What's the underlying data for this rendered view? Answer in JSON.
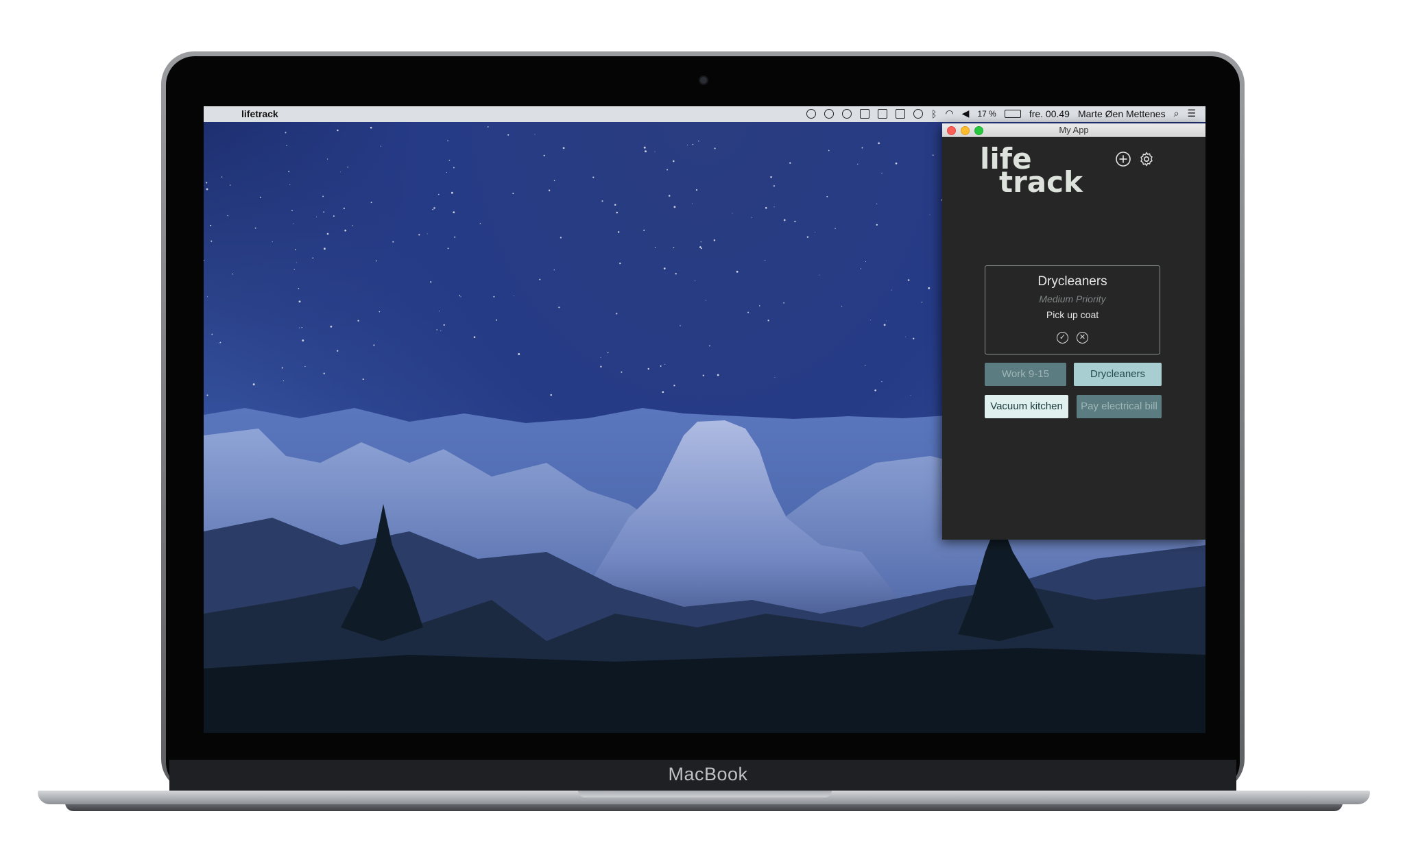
{
  "device": {
    "brand_label": "MacBook"
  },
  "menubar": {
    "apple_glyph": "",
    "app_name": "lifetrack",
    "status_icons": [
      "creative-cloud-icon",
      "target-icon",
      "timer-icon",
      "drive-icon",
      "dropbox-icon",
      "airplay-icon",
      "time-machine-icon",
      "bluetooth-icon",
      "wifi-icon",
      "volume-icon"
    ],
    "battery": "17 %",
    "clock": "fre. 00.49",
    "user": "Marte Øen Mettenes"
  },
  "window": {
    "title": "My App",
    "logo_line1": "life",
    "logo_line2": "track"
  },
  "current_task": {
    "title": "Drycleaners",
    "priority": "Medium Priority",
    "description": "Pick up coat"
  },
  "tasks": [
    {
      "label": "Work 9-15",
      "style": "dark"
    },
    {
      "label": "Drycleaners",
      "style": "light"
    },
    {
      "label": "Vacuum kitchen",
      "style": "white"
    },
    {
      "label": "Pay electrical bill",
      "style": "dark"
    }
  ],
  "colors": {
    "window_bg": "#262626",
    "tag_dark": "#5b7c80",
    "tag_light": "#a9ced1",
    "tag_white": "#dff0ef"
  }
}
